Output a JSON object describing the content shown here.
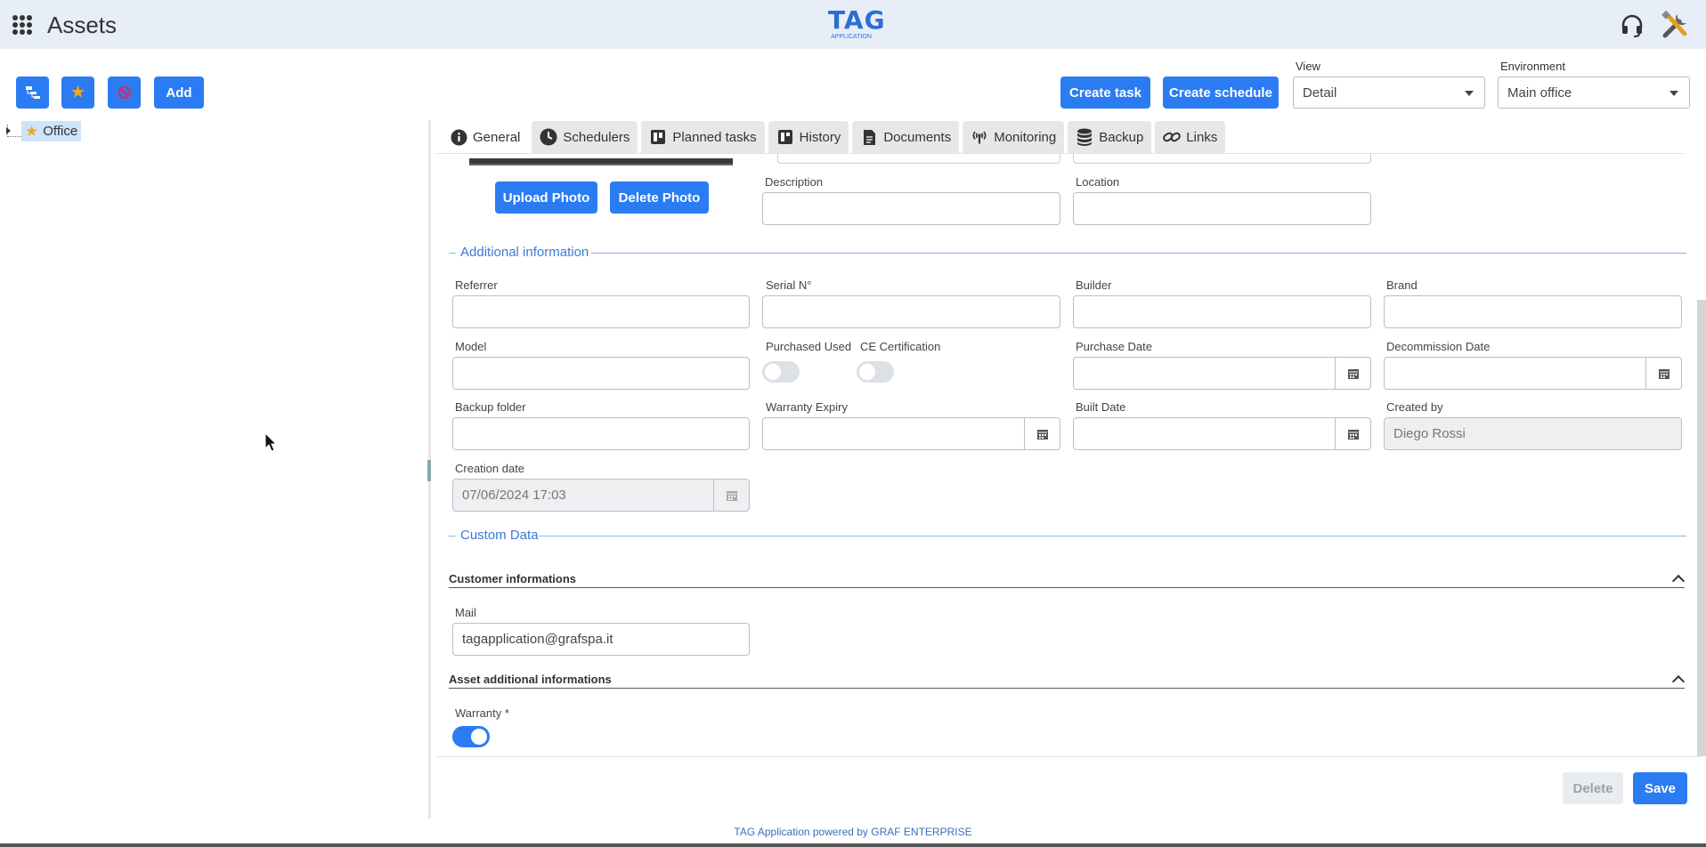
{
  "header": {
    "app_title": "Assets",
    "logo_text": "TAG",
    "logo_subtext": "APPLICATION"
  },
  "toolbar": {
    "add_label": "Add",
    "create_task_label": "Create task",
    "create_schedule_label": "Create schedule",
    "view_label": "View",
    "view_value": "Detail",
    "environment_label": "Environment",
    "environment_value": "Main office"
  },
  "tree": {
    "nodes": [
      {
        "label": "Office",
        "icon": "star-icon"
      }
    ]
  },
  "tabs": [
    {
      "label": "General",
      "icon": "info-icon"
    },
    {
      "label": "Schedulers",
      "icon": "clock-icon"
    },
    {
      "label": "Planned tasks",
      "icon": "board-icon"
    },
    {
      "label": "History",
      "icon": "book-icon"
    },
    {
      "label": "Documents",
      "icon": "document-icon"
    },
    {
      "label": "Monitoring",
      "icon": "antenna-icon"
    },
    {
      "label": "Backup",
      "icon": "database-icon"
    },
    {
      "label": "Links",
      "icon": "link-icon"
    }
  ],
  "photo": {
    "upload_label": "Upload Photo",
    "delete_label": "Delete Photo"
  },
  "general": {
    "description_label": "Description",
    "description_value": "",
    "location_label": "Location",
    "location_value": ""
  },
  "additional": {
    "title": "Additional information",
    "referrer_label": "Referrer",
    "serial_label": "Serial N°",
    "builder_label": "Builder",
    "brand_label": "Brand",
    "model_label": "Model",
    "purchased_used_label": "Purchased Used",
    "purchased_used_on": false,
    "ce_certification_label": "CE Certification",
    "ce_certification_on": false,
    "purchase_date_label": "Purchase Date",
    "decommission_date_label": "Decommission Date",
    "backup_folder_label": "Backup folder",
    "warranty_expiry_label": "Warranty Expiry",
    "built_date_label": "Built Date",
    "created_by_label": "Created by",
    "created_by_value": "Diego Rossi",
    "creation_date_label": "Creation date",
    "creation_date_value": "07/06/2024 17:03"
  },
  "custom_data": {
    "title": "Custom Data",
    "customer_group_title": "Customer informations",
    "mail_label": "Mail",
    "mail_value": "tagapplication@grafspa.it",
    "asset_group_title": "Asset additional informations",
    "warranty_label": "Warranty *",
    "warranty_on": true
  },
  "footer": {
    "delete_label": "Delete",
    "save_label": "Save",
    "powered_by": "TAG Application powered by GRAF ENTERPRISE"
  },
  "colors": {
    "primary": "#2b7cf3",
    "header_bg": "#e8eef8",
    "section_title": "#3a7ad8"
  }
}
